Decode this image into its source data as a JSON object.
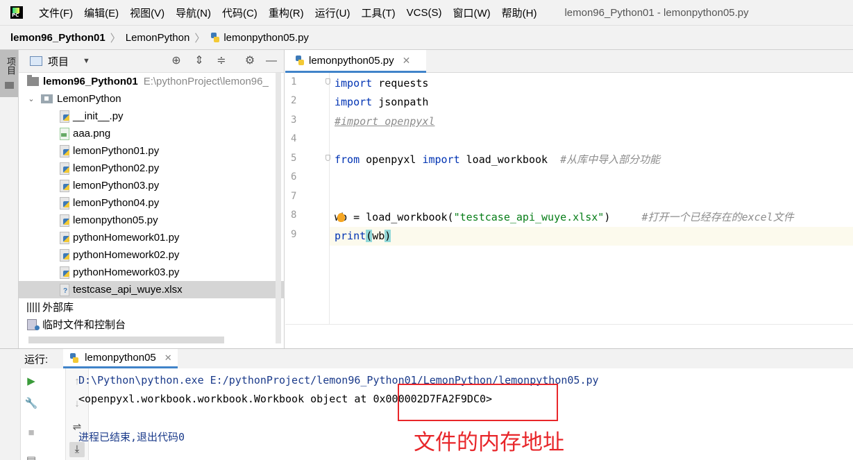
{
  "menu": {
    "items": [
      "文件(F)",
      "编辑(E)",
      "视图(V)",
      "导航(N)",
      "代码(C)",
      "重构(R)",
      "运行(U)",
      "工具(T)",
      "VCS(S)",
      "窗口(W)",
      "帮助(H)"
    ],
    "window_title": "lemon96_Python01 - lemonpython05.py"
  },
  "breadcrumb": {
    "project": "lemon96_Python01",
    "folder": "LemonPython",
    "file": "lemonpython05.py"
  },
  "toolstrip": {
    "project_tab": "项目"
  },
  "project_panel": {
    "title": "项目",
    "root_name": "lemon96_Python01",
    "root_path": "E:\\pythonProject\\lemon96_",
    "package_name": "LemonPython",
    "files": [
      {
        "name": "__init__.py",
        "type": "py"
      },
      {
        "name": "aaa.png",
        "type": "img"
      },
      {
        "name": "lemonPython01.py",
        "type": "py"
      },
      {
        "name": "lemonPython02.py",
        "type": "py"
      },
      {
        "name": "lemonPython03.py",
        "type": "py"
      },
      {
        "name": "lemonPython04.py",
        "type": "py"
      },
      {
        "name": "lemonpython05.py",
        "type": "py"
      },
      {
        "name": "pythonHomework01.py",
        "type": "py"
      },
      {
        "name": "pythonHomework02.py",
        "type": "py"
      },
      {
        "name": "pythonHomework03.py",
        "type": "py"
      },
      {
        "name": "testcase_api_wuye.xlsx",
        "type": "xlsx"
      }
    ],
    "external_libs": "外部库",
    "scratches": "临时文件和控制台"
  },
  "editor": {
    "tab_label": "lemonpython05.py",
    "line_numbers": [
      "1",
      "2",
      "3",
      "4",
      "5",
      "6",
      "7",
      "8",
      "9"
    ],
    "code": {
      "l1_kw": "import",
      "l1_rest": " requests",
      "l2_kw": "import",
      "l2_rest": " jsonpath",
      "l3_cmt": "#import openpyxl",
      "l5_kw1": "from",
      "l5_mid": " openpyxl ",
      "l5_kw2": "import",
      "l5_rest": " load_workbook  ",
      "l5_cmt": "#从库中导入部分功能",
      "l8_a": "w",
      "l8_b": "b",
      "l8_mid": " = load_workbook(",
      "l8_str": "\"testcase_api_wuye.xlsx\"",
      "l8_close": ")     ",
      "l8_cmt": "#打开一个已经存在的excel文件",
      "l9_kw": "print",
      "l9_open": "(",
      "l9_arg": "wb",
      "l9_close": ")"
    }
  },
  "run_panel": {
    "label": "运行:",
    "tab_label": "lemonpython05",
    "console": {
      "line1": "D:\\Python\\python.exe E:/pythonProject/lemon96_Python01/LemonPython/lemonpython05.py",
      "line2": "<openpyxl.workbook.workbook.Workbook object at 0x000002D7FA2F9DC0>",
      "line3": "进程已结束,退出代码0"
    }
  },
  "annotation": {
    "text": "文件的内存地址",
    "color": "#e8262a"
  },
  "colors": {
    "accent": "#4083c9",
    "keyword": "#0033b3",
    "string": "#067d17",
    "comment": "#8c8c8c",
    "run_green": "#3a9b3a"
  }
}
